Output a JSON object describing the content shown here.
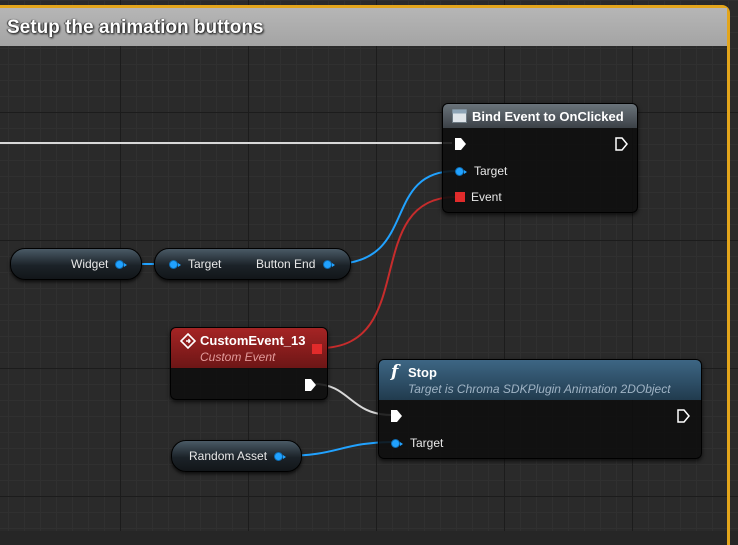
{
  "comment": {
    "title": "Setup the animation buttons"
  },
  "colors": {
    "comment_border": "#e3a51b",
    "object_pin": "#21a2ff",
    "delegate_pin": "#e12b2b",
    "event_header": "#a52424",
    "function_header": "#3d6684"
  },
  "bind_node": {
    "title": "Bind Event to OnClicked",
    "icon": "delegate-icon",
    "pins": {
      "target": "Target",
      "event": "Event"
    }
  },
  "widget_var": {
    "label": "Widget"
  },
  "button_getter": {
    "input_label": "Target",
    "output_label": "Button End"
  },
  "custom_event": {
    "title": "CustomEvent_13",
    "subtitle": "Custom Event",
    "icon": "event-icon"
  },
  "stop_node": {
    "title": "Stop",
    "subtitle": "Target is Chroma SDKPlugin Animation 2DObject",
    "icon": "function-icon",
    "icon_glyph": "f",
    "pins": {
      "target": "Target"
    }
  },
  "random_asset": {
    "label": "Random Asset"
  }
}
